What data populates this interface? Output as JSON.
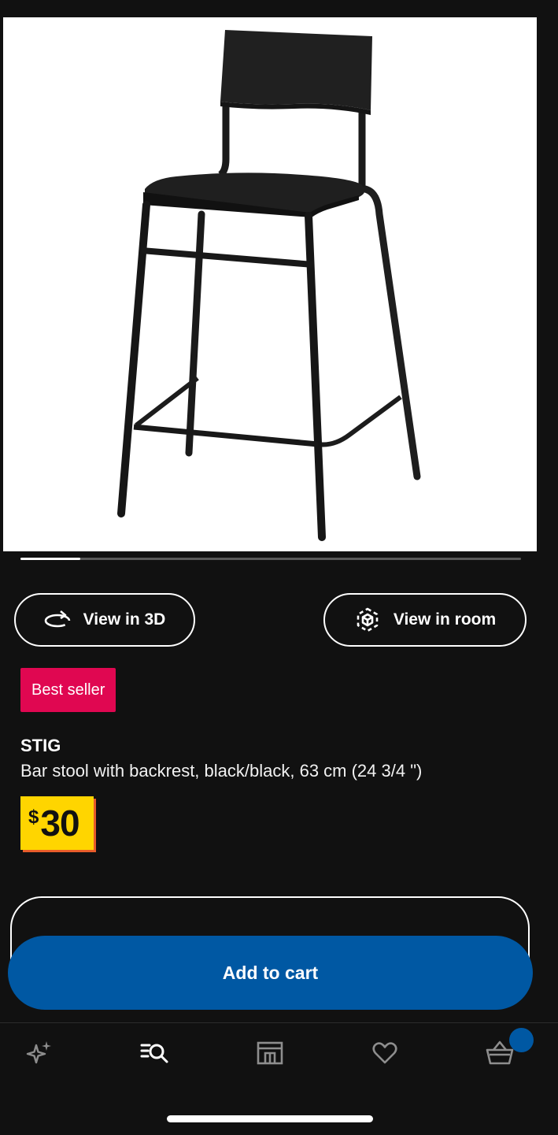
{
  "product": {
    "badge": "Best seller",
    "name": "STIG",
    "description": "Bar stool with backrest, black/black, 63 cm (24 3/4 \")",
    "price_currency": "$",
    "price_amount": "30",
    "image_alt": "stool"
  },
  "carousel": {
    "progress": 0.12
  },
  "actions": {
    "view_3d_label": "View in 3D",
    "view_room_label": "View in room",
    "add_to_cart_label": "Add to cart"
  },
  "bottom_nav": {
    "items": [
      {
        "icon": "sparkle-icon"
      },
      {
        "icon": "search-list-icon"
      },
      {
        "icon": "store-icon"
      },
      {
        "icon": "heart-icon"
      },
      {
        "icon": "basket-icon"
      }
    ]
  },
  "colors": {
    "background": "#111111",
    "brand_blue": "#0058a3",
    "badge_red": "#e00751",
    "price_yellow": "#ffd500"
  }
}
